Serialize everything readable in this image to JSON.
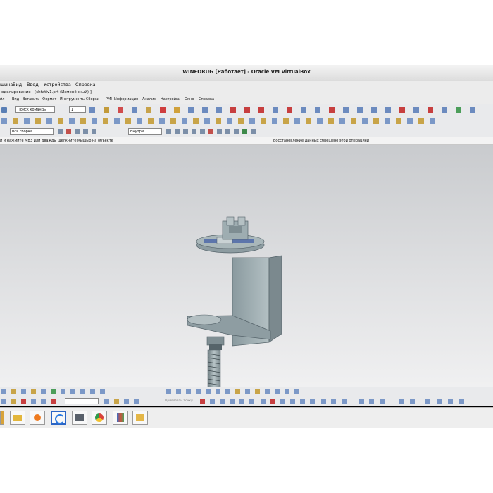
{
  "window": {
    "title": "WINFORUG [Работает] - Oracle VM VirtualBox"
  },
  "vbox_menu": {
    "items": [
      "шина",
      "Вид",
      "Ввод",
      "Устройства",
      "Справка"
    ]
  },
  "nx": {
    "title": "оделирование - [shtativ1.prt (Изменённый) ]",
    "menu": [
      "йл",
      "Вид",
      "Вставить",
      "Формат",
      "Инструменты",
      "Сборки",
      "PMI",
      "Информация",
      "Анализ",
      "Настройки",
      "Окно",
      "Справка"
    ],
    "command_search_placeholder": "Поиск команды",
    "layer_value": "1",
    "filter_value": "Вся сборка",
    "scope_value": "Внутри",
    "snap_hint": "Привязать точку",
    "cue_line": "и и нажмите MB3 или дважды щелкните мышью на объекте",
    "status_line": "Восстановление данных сброшено этой операцией"
  },
  "accent_colors": {
    "part": "#9aa9ad",
    "part_dark": "#6d7c81",
    "viewport_top": "#c9cbce",
    "viewport_bottom": "#f0f0f1"
  }
}
